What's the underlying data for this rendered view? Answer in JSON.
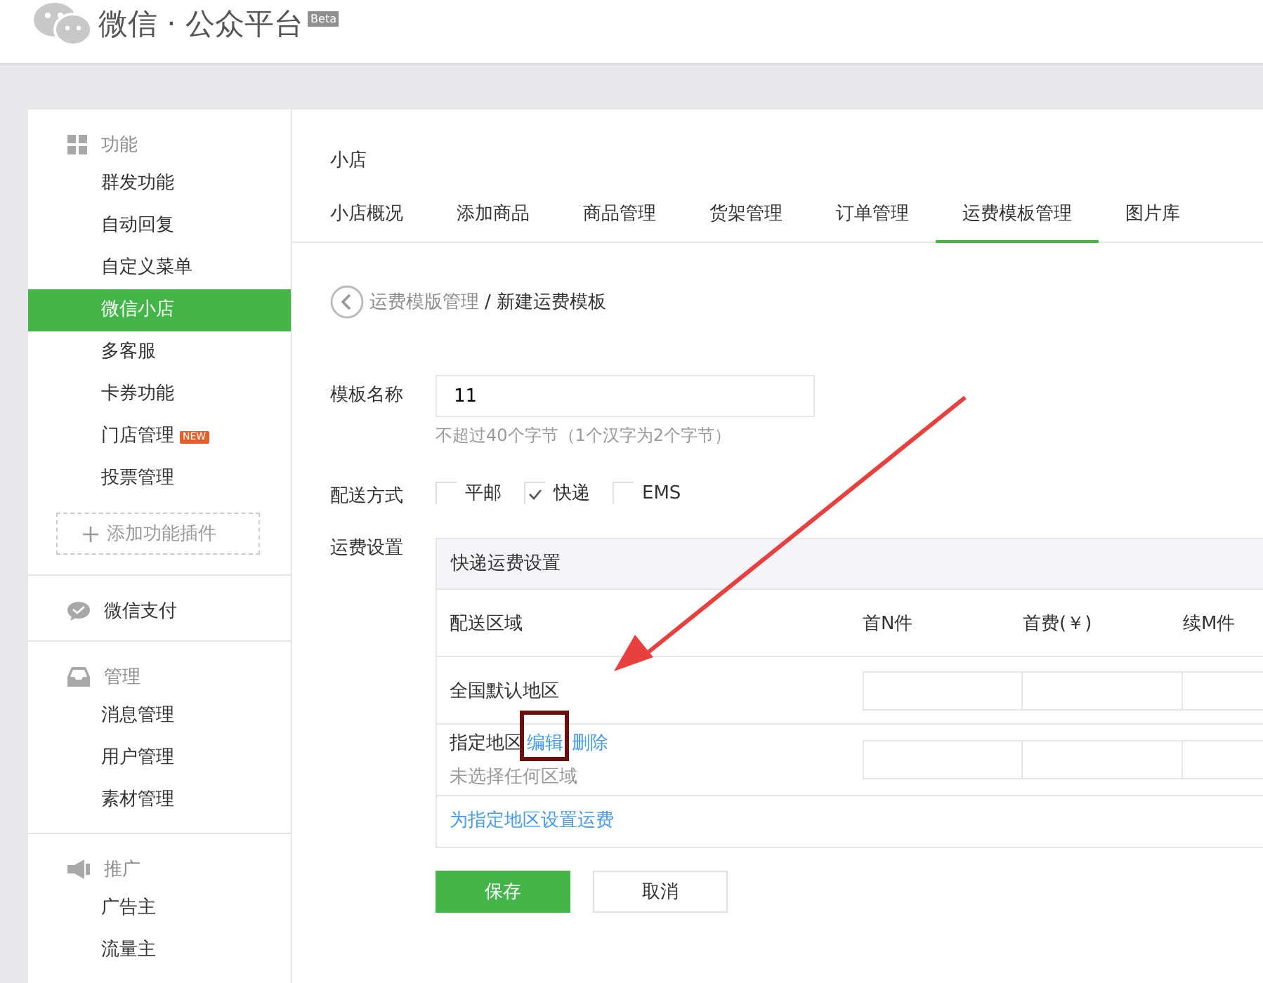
{
  "header": {
    "title": "微信 · 公众平台",
    "badge": "Beta"
  },
  "sidebar": {
    "sections": [
      {
        "label": "功能",
        "items": [
          {
            "label": "群发功能",
            "selected": false
          },
          {
            "label": "自动回复",
            "selected": false
          },
          {
            "label": "自定义菜单",
            "selected": false
          },
          {
            "label": "微信小店",
            "selected": true
          },
          {
            "label": "多客服",
            "selected": false
          },
          {
            "label": "卡券功能",
            "selected": false
          },
          {
            "label": "门店管理",
            "selected": false,
            "badge": "NEW"
          },
          {
            "label": "投票管理",
            "selected": false
          }
        ],
        "add_button": "添加功能插件"
      },
      {
        "label": "微信支付"
      },
      {
        "label": "管理",
        "items": [
          {
            "label": "消息管理",
            "selected": false
          },
          {
            "label": "用户管理",
            "selected": false
          },
          {
            "label": "素材管理",
            "selected": false
          }
        ]
      },
      {
        "label": "推广",
        "items": [
          {
            "label": "广告主",
            "selected": false
          },
          {
            "label": "流量主",
            "selected": false
          }
        ]
      }
    ]
  },
  "main": {
    "title": "小店",
    "tabs": [
      {
        "label": "小店概况",
        "selected": false
      },
      {
        "label": "添加商品",
        "selected": false
      },
      {
        "label": "商品管理",
        "selected": false
      },
      {
        "label": "货架管理",
        "selected": false
      },
      {
        "label": "订单管理",
        "selected": false
      },
      {
        "label": "运费模板管理",
        "selected": true
      },
      {
        "label": "图片库",
        "selected": false
      }
    ],
    "breadcrumb": {
      "parent": "运费模版管理",
      "separator": "/",
      "current": "新建运费模板"
    },
    "form": {
      "name_label": "模板名称",
      "name_value": "11",
      "name_hint": "不超过40个字节（1个汉字为2个字节）",
      "delivery_label": "配送方式",
      "delivery_options": [
        {
          "label": "平邮",
          "checked": false
        },
        {
          "label": "快递",
          "checked": true
        },
        {
          "label": "EMS",
          "checked": false
        }
      ],
      "fee_label": "运费设置",
      "fee_table": {
        "title": "快递运费设置",
        "columns": [
          "配送区域",
          "首N件",
          "首费(￥)",
          "续M件"
        ],
        "rows": [
          {
            "kind": "default",
            "region": "全国默认地区"
          },
          {
            "kind": "custom",
            "region": "指定地区",
            "actions": [
              {
                "label": "编辑",
                "highlighted": true
              },
              {
                "label": "删除",
                "highlighted": false
              }
            ],
            "note": "未选择任何区域"
          }
        ],
        "footer_link": "为指定地区设置运费"
      }
    },
    "buttons": [
      {
        "label": "保存",
        "kind": "primary"
      },
      {
        "label": "取消",
        "kind": "default"
      }
    ]
  },
  "annotation_arrow": true
}
